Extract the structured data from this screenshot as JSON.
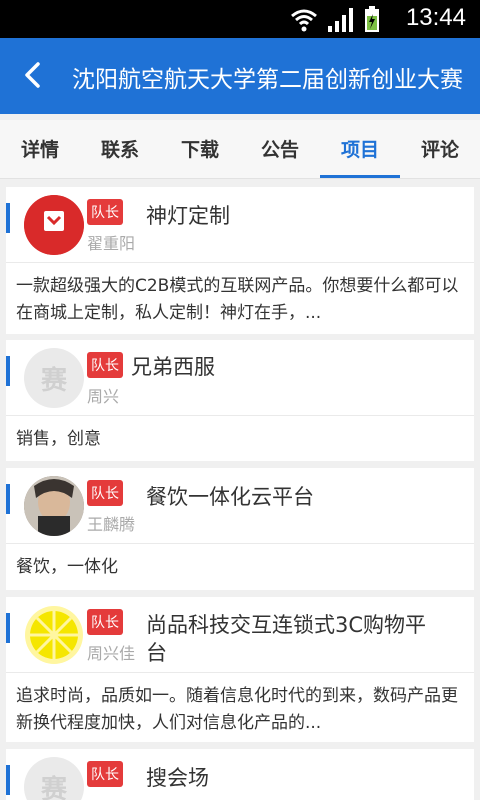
{
  "status": {
    "time": "13:44"
  },
  "appbar": {
    "title": "沈阳航空航天大学第二届创新创业大赛"
  },
  "tabs": [
    {
      "label": "详情"
    },
    {
      "label": "联系"
    },
    {
      "label": "下载"
    },
    {
      "label": "公告"
    },
    {
      "label": "项目"
    },
    {
      "label": "评论"
    }
  ],
  "projects": [
    {
      "badge": "队长",
      "name": "神灯定制",
      "leader": "翟重阳",
      "desc": "一款超级强大的C2B模式的互联网产品。你想要什么都可以在商城上定制，私人定制！神灯在手，...",
      "logo_text": "神灯定制"
    },
    {
      "badge": "队长",
      "name": "兄弟西服",
      "leader": "周兴",
      "desc": "销售，创意",
      "logo_text": "赛"
    },
    {
      "badge": "队长",
      "name": "餐饮一体化云平台",
      "leader": "王麟腾",
      "desc": "餐饮，一体化"
    },
    {
      "badge": "队长",
      "name_line1": "尚品科技交互连锁式3C购物平",
      "name_line2": "台",
      "leader": "周兴佳",
      "desc": "追求时尚，品质如一。随着信息化时代的到来，数码产品更新换代程度加快，人们对信息化产品的..."
    },
    {
      "badge": "队长",
      "name": "搜会场",
      "logo_text": "赛"
    }
  ]
}
